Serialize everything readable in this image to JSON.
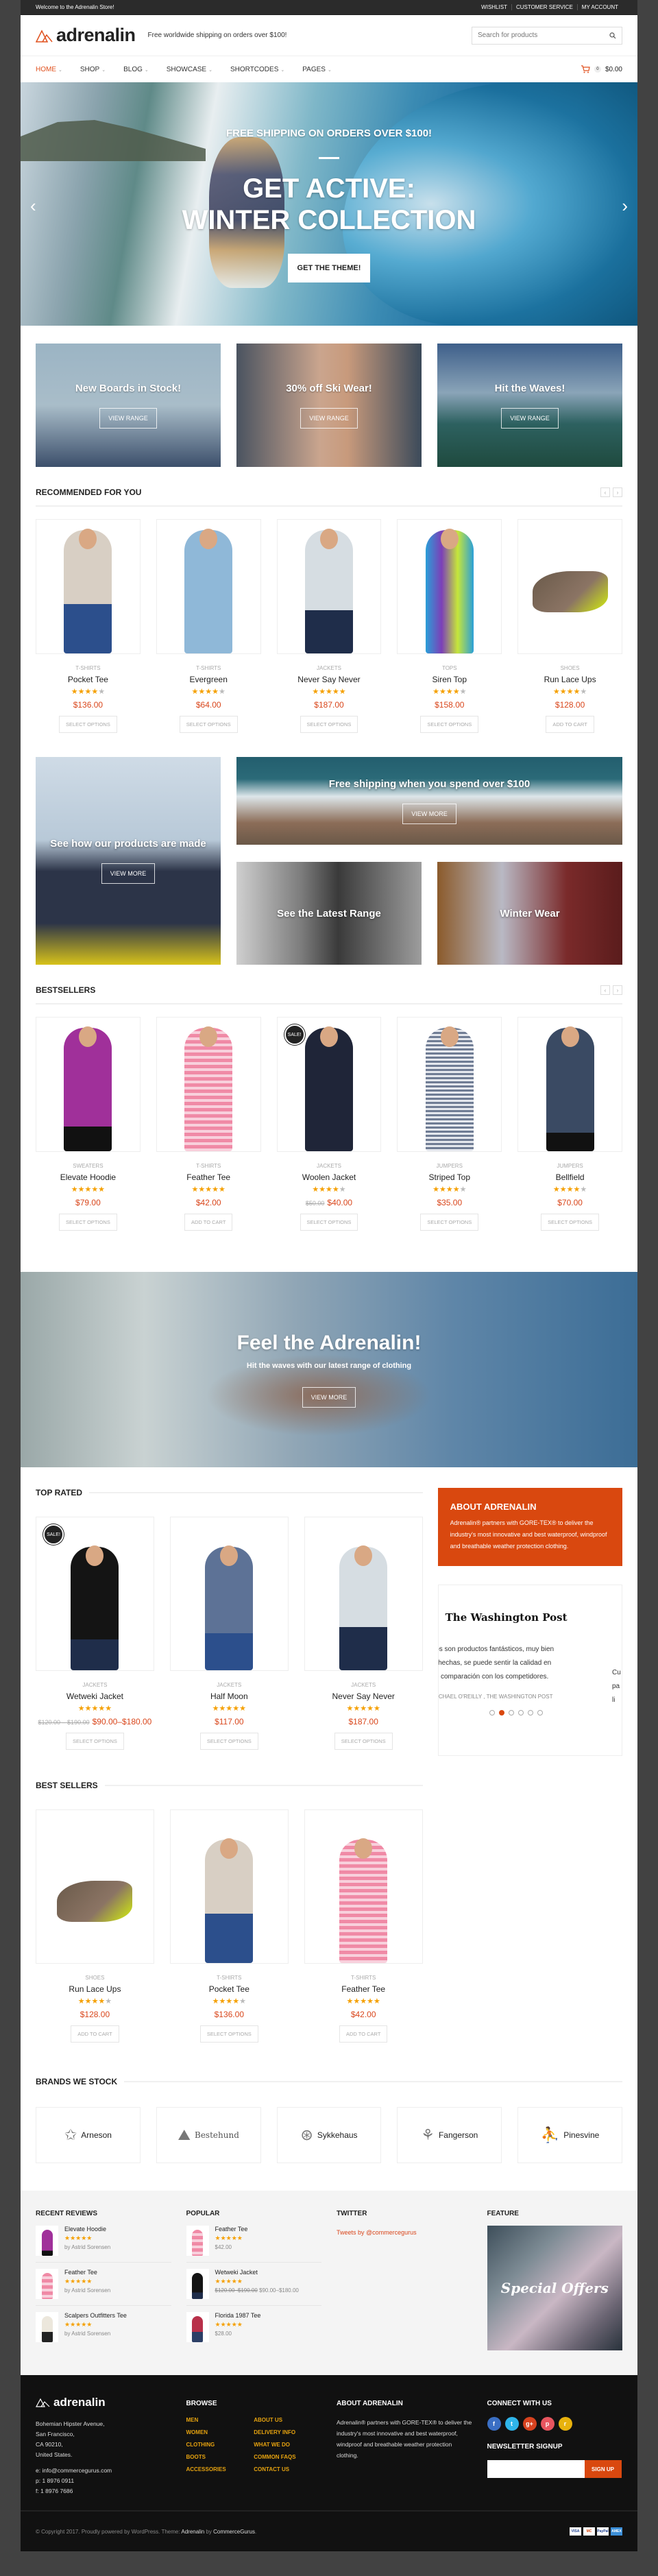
{
  "topbar": {
    "welcome": "Welcome to the Adrenalin Store!",
    "links": [
      "WISHLIST",
      "CUSTOMER SERVICE",
      "MY ACCOUNT"
    ]
  },
  "header": {
    "logo": "adrenalin",
    "tagline": "Free worldwide shipping on orders over $100!",
    "search_placeholder": "Search for products"
  },
  "nav": {
    "items": [
      "HOME",
      "SHOP",
      "BLOG",
      "SHOWCASE",
      "SHORTCODES",
      "PAGES"
    ],
    "active": "HOME",
    "cart_count": "0",
    "cart_total": "$0.00"
  },
  "hero": {
    "kicker": "FREE SHIPPING ON ORDERS OVER $100!",
    "title_line1": "GET ACTIVE:",
    "title_line2": "WINTER COLLECTION",
    "cta": "GET THE THEME!"
  },
  "promos": [
    {
      "title": "New Boards in Stock!",
      "button": "VIEW RANGE"
    },
    {
      "title": "30% off Ski Wear!",
      "button": "VIEW RANGE"
    },
    {
      "title": "Hit the Waves!",
      "button": "VIEW RANGE"
    }
  ],
  "recommended": {
    "title": "RECOMMENDED FOR YOU",
    "products": [
      {
        "category": "T-SHIRTS",
        "name": "Pocket Tee",
        "rating": 4,
        "price": "$136.00",
        "button": "SELECT OPTIONS"
      },
      {
        "category": "T-SHIRTS",
        "name": "Evergreen",
        "rating": 4.5,
        "price": "$64.00",
        "button": "SELECT OPTIONS"
      },
      {
        "category": "JACKETS",
        "name": "Never Say Never",
        "rating": 5,
        "price": "$187.00",
        "button": "SELECT OPTIONS"
      },
      {
        "category": "TOPS",
        "name": "Siren Top",
        "rating": 4.5,
        "price": "$158.00",
        "button": "SELECT OPTIONS"
      },
      {
        "category": "SHOES",
        "name": "Run Lace Ups",
        "rating": 4.5,
        "price": "$128.00",
        "button": "ADD TO CART"
      }
    ]
  },
  "mosaic": {
    "tile1": {
      "title": "See how our products are made",
      "button": "VIEW MORE"
    },
    "tile2": {
      "title": "Free shipping when you spend over $100",
      "button": "VIEW MORE"
    },
    "tile3": {
      "title": "See the Latest Range"
    },
    "tile4": {
      "title": "Winter Wear"
    }
  },
  "bestsellers": {
    "title": "BESTSELLERS",
    "products": [
      {
        "category": "SWEATERS",
        "name": "Elevate Hoodie",
        "rating": 5,
        "price": "$79.00",
        "button": "SELECT OPTIONS"
      },
      {
        "category": "T-SHIRTS",
        "name": "Feather Tee",
        "rating": 5,
        "price": "$42.00",
        "button": "ADD TO CART"
      },
      {
        "category": "JACKETS",
        "name": "Woolen Jacket",
        "rating": 4.5,
        "old_price": "$50.00",
        "price": "$40.00",
        "button": "SELECT OPTIONS",
        "sale": "SALE!"
      },
      {
        "category": "JUMPERS",
        "name": "Striped Top",
        "rating": 4.5,
        "price": "$35.00",
        "button": "SELECT OPTIONS"
      },
      {
        "category": "JUMPERS",
        "name": "Bellfield",
        "rating": 4.5,
        "price": "$70.00",
        "button": "SELECT OPTIONS"
      }
    ]
  },
  "feel": {
    "title": "Feel the Adrenalin!",
    "subtitle": "Hit the waves with our latest range of clothing",
    "button": "VIEW MORE"
  },
  "top_rated": {
    "title": "TOP RATED",
    "products": [
      {
        "category": "JACKETS",
        "name": "Wetweki Jacket",
        "rating": 5,
        "old_price": "$120.00 – $190.00",
        "price": "$90.00–$180.00",
        "button": "SELECT OPTIONS",
        "sale": "SALE!"
      },
      {
        "category": "JACKETS",
        "name": "Half Moon",
        "rating": 5,
        "price": "$117.00",
        "button": "SELECT OPTIONS"
      },
      {
        "category": "JACKETS",
        "name": "Never Say Never",
        "rating": 5,
        "price": "$187.00",
        "button": "SELECT OPTIONS"
      }
    ]
  },
  "best_sellers": {
    "title": "BEST SELLERS",
    "products": [
      {
        "category": "SHOES",
        "name": "Run Lace Ups",
        "rating": 4.5,
        "price": "$128.00",
        "button": "ADD TO CART"
      },
      {
        "category": "T-SHIRTS",
        "name": "Pocket Tee",
        "rating": 4,
        "price": "$136.00",
        "button": "SELECT OPTIONS"
      },
      {
        "category": "T-SHIRTS",
        "name": "Feather Tee",
        "rating": 5,
        "price": "$42.00",
        "button": "ADD TO CART"
      }
    ]
  },
  "about_box": {
    "title": "ABOUT ADRENALIN",
    "text": "Adrenalin® partners with GORE-TEX® to deliver the industry's most innovative and best waterproof, windproof and breathable weather protection clothing."
  },
  "testimonial": {
    "source": "The Washington Post",
    "quote": "os son productos fantásticos, muy bien hechas, se puede sentir la calidad en comparación con los competidores.",
    "next_quote_fragment": "Cu pa li",
    "attribution": "ICHAEL O'REILLY , THE WASHINGTON POST",
    "slides": 6,
    "active_slide": 2
  },
  "brands": {
    "title": "BRANDS WE STOCK",
    "items": [
      "Arneson",
      "Bestehund",
      "Sykkehaus",
      "Fangerson",
      "Pinesvine"
    ]
  },
  "widgets": {
    "recent_reviews": {
      "title": "RECENT REVIEWS",
      "items": [
        {
          "name": "Elevate Hoodie",
          "rating": 5,
          "by": "by Astrid Sorensen"
        },
        {
          "name": "Feather Tee",
          "rating": 5,
          "by": "by Astrid Sorensen"
        },
        {
          "name": "Scalpers Outfitters Tee",
          "rating": 5,
          "by": "by Astrid Sorensen"
        }
      ]
    },
    "popular": {
      "title": "POPULAR",
      "items": [
        {
          "name": "Feather Tee",
          "rating": 5,
          "price": "$42.00"
        },
        {
          "name": "Wetweki Jacket",
          "rating": 5,
          "old_price": "$120.00–$190.00",
          "price": "$90.00–$180.00"
        },
        {
          "name": "Florida 1987 Tee",
          "rating": 4.5,
          "price": "$28.00"
        }
      ]
    },
    "twitter": {
      "title": "TWITTER",
      "link": "Tweets by @commercegurus"
    },
    "feature": {
      "title": "FEATURE",
      "image_text": "Special Offers"
    }
  },
  "footer": {
    "logo": "adrenalin",
    "address": [
      "Bohemian Hipster Avenue,",
      "San Francisco,",
      "CA 90210,",
      "United States."
    ],
    "email": "e: info@commercegurus.com",
    "phone": "p: 1 8976 0911",
    "fax": "f: 1 8976 7686",
    "browse_title": "BROWSE",
    "browse_links": [
      "MEN",
      "ABOUT US",
      "WOMEN",
      "DELIVERY INFO",
      "CLOTHING",
      "WHAT WE DO",
      "BOOTS",
      "COMMON FAQS",
      "ACCESSORIES",
      "CONTACT US"
    ],
    "about_title": "ABOUT ADRENALIN",
    "about_text": "Adrenalin® partners with GORE-TEX® to deliver the industry's most innovative and best waterproof, windproof and breathable weather protection clothing.",
    "connect_title": "CONNECT WITH US",
    "social": [
      {
        "name": "facebook",
        "glyph": "f",
        "color": "#3b6fc4"
      },
      {
        "name": "twitter",
        "glyph": "t",
        "color": "#2fb5ea"
      },
      {
        "name": "google-plus",
        "glyph": "g+",
        "color": "#d7421f"
      },
      {
        "name": "pinterest",
        "glyph": "p",
        "color": "#e8555f"
      },
      {
        "name": "rss",
        "glyph": "r",
        "color": "#e8b20d"
      }
    ],
    "newsletter_title": "NEWSLETTER SIGNUP",
    "signup_button": "SIGN UP",
    "copyright_prefix": "© Copyright 2017. Proudly powered by WordPress. Theme: ",
    "theme": "Adrenalin",
    "by": " by ",
    "author": "CommerceGurus",
    "suffix": ".",
    "payment_cards": [
      "VISA",
      "MC",
      "PayPal",
      "AMEX"
    ]
  },
  "colors": {
    "accent": "#d9480f",
    "price": "#d9461b",
    "star": "#f5a000",
    "footer_link": "#e5a20f"
  }
}
